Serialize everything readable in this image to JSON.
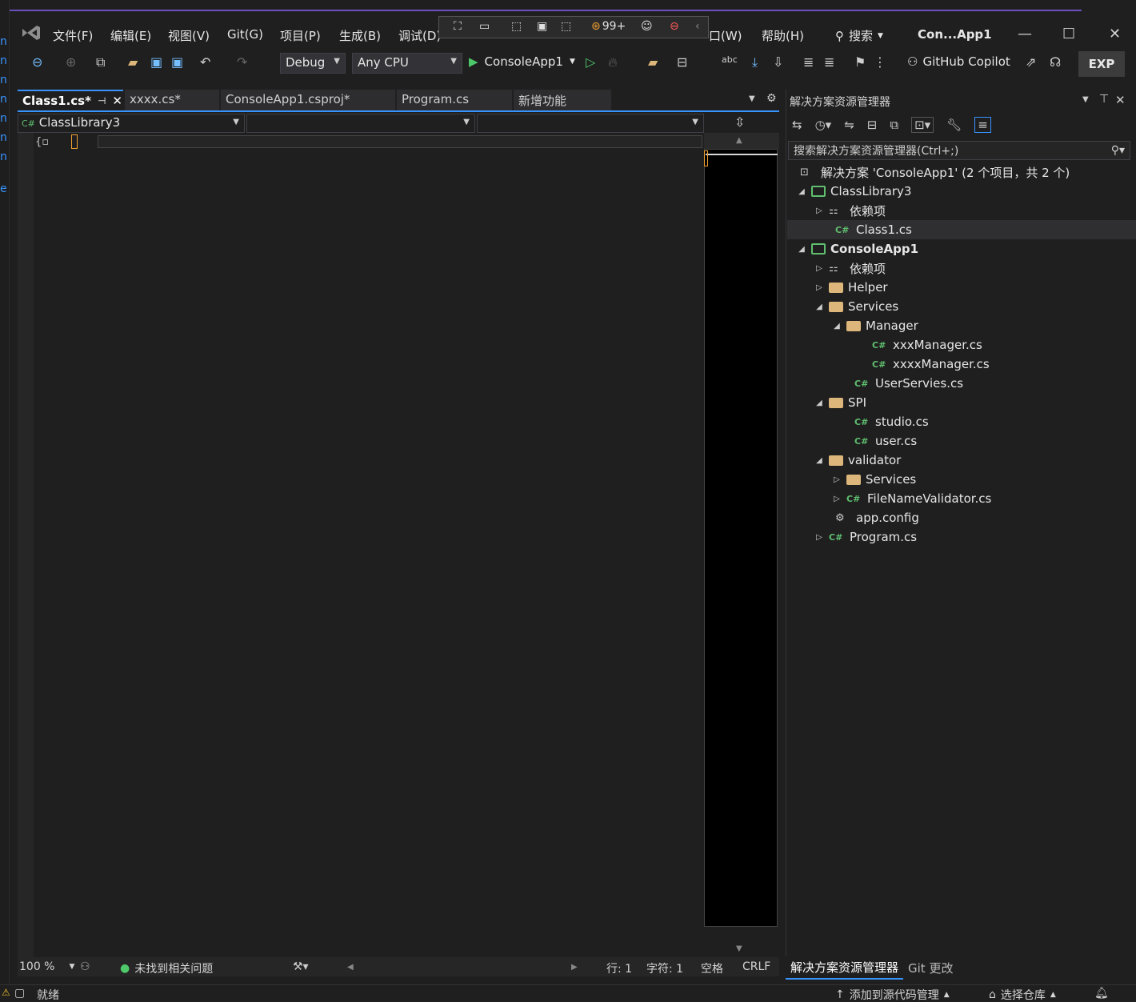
{
  "menu": {
    "items": [
      "文件(F)",
      "编辑(E)",
      "视图(V)",
      "Git(G)",
      "项目(P)",
      "生成(B)",
      "调试(D)",
      "口(W)",
      "帮助(H)"
    ],
    "search_label": "搜索",
    "title": "Con...App1"
  },
  "debug_toolbar": {
    "badge": "99+"
  },
  "toolbar": {
    "config": "Debug",
    "platform": "Any CPU",
    "start_label": "ConsoleApp1",
    "copilot_label": "GitHub Copilot",
    "exp_label": "EXP"
  },
  "tabs": [
    {
      "label": "Class1.cs*",
      "active": true
    },
    {
      "label": "xxxx.cs*",
      "active": false
    },
    {
      "label": "ConsoleApp1.csproj*",
      "active": false
    },
    {
      "label": "Program.cs",
      "active": false
    },
    {
      "label": "新增功能",
      "active": false
    }
  ],
  "navbar": {
    "project": "ClassLibrary3"
  },
  "editor_status": {
    "zoom": "100 %",
    "issues": "未找到相关问题",
    "line": "行: 1",
    "col": "字符: 1",
    "spaces": "空格",
    "eol": "CRLF"
  },
  "solution_explorer": {
    "title": "解决方案资源管理器",
    "search_placeholder": "搜索解决方案资源管理器(Ctrl+;)",
    "tree": [
      {
        "label": "解决方案 'ConsoleApp1' (2 个项目，共 2 个)",
        "icon": "solution-icon",
        "depth": 0,
        "twisty": ""
      },
      {
        "label": "ClassLibrary3",
        "icon": "project-icon",
        "depth": 1,
        "twisty": "expanded"
      },
      {
        "label": "依赖项",
        "icon": "dependencies-icon",
        "depth": 2,
        "twisty": "collapsed"
      },
      {
        "label": "Class1.cs",
        "icon": "csharp-file-icon",
        "depth": 2,
        "twisty": ""
      },
      {
        "label": "ConsoleApp1",
        "icon": "project-icon",
        "depth": 1,
        "twisty": "expanded"
      },
      {
        "label": "依赖项",
        "icon": "dependencies-icon",
        "depth": 2,
        "twisty": "collapsed"
      },
      {
        "label": "Helper",
        "icon": "folder-icon",
        "depth": 2,
        "twisty": "collapsed"
      },
      {
        "label": "Services",
        "icon": "folder-icon",
        "depth": 2,
        "twisty": "expanded"
      },
      {
        "label": "Manager",
        "icon": "folder-icon",
        "depth": 3,
        "twisty": "expanded"
      },
      {
        "label": "xxxManager.cs",
        "icon": "csharp-file-icon",
        "depth": 4,
        "twisty": ""
      },
      {
        "label": "xxxxManager.cs",
        "icon": "csharp-file-icon",
        "depth": 4,
        "twisty": ""
      },
      {
        "label": "UserServies.cs",
        "icon": "csharp-file-icon",
        "depth": 3,
        "twisty": ""
      },
      {
        "label": "SPI",
        "icon": "folder-icon",
        "depth": 2,
        "twisty": "expanded"
      },
      {
        "label": "studio.cs",
        "icon": "csharp-file-icon",
        "depth": 3,
        "twisty": ""
      },
      {
        "label": "user.cs",
        "icon": "csharp-file-icon",
        "depth": 3,
        "twisty": ""
      },
      {
        "label": "validator",
        "icon": "folder-icon",
        "depth": 2,
        "twisty": "expanded"
      },
      {
        "label": "Services",
        "icon": "folder-icon",
        "depth": 3,
        "twisty": "collapsed"
      },
      {
        "label": "FileNameValidator.cs",
        "icon": "csharp-file-icon",
        "depth": 3,
        "twisty": "collapsed"
      },
      {
        "label": "app.config",
        "icon": "config-file-icon",
        "depth": 2,
        "twisty": ""
      },
      {
        "label": "Program.cs",
        "icon": "csharp-file-icon",
        "depth": 2,
        "twisty": "collapsed"
      }
    ],
    "bottom_tabs": [
      "解决方案资源管理器",
      "Git 更改"
    ]
  },
  "status_bar": {
    "ready": "就绪",
    "add_source": "添加到源代码管理",
    "select_repo": "选择仓库"
  }
}
